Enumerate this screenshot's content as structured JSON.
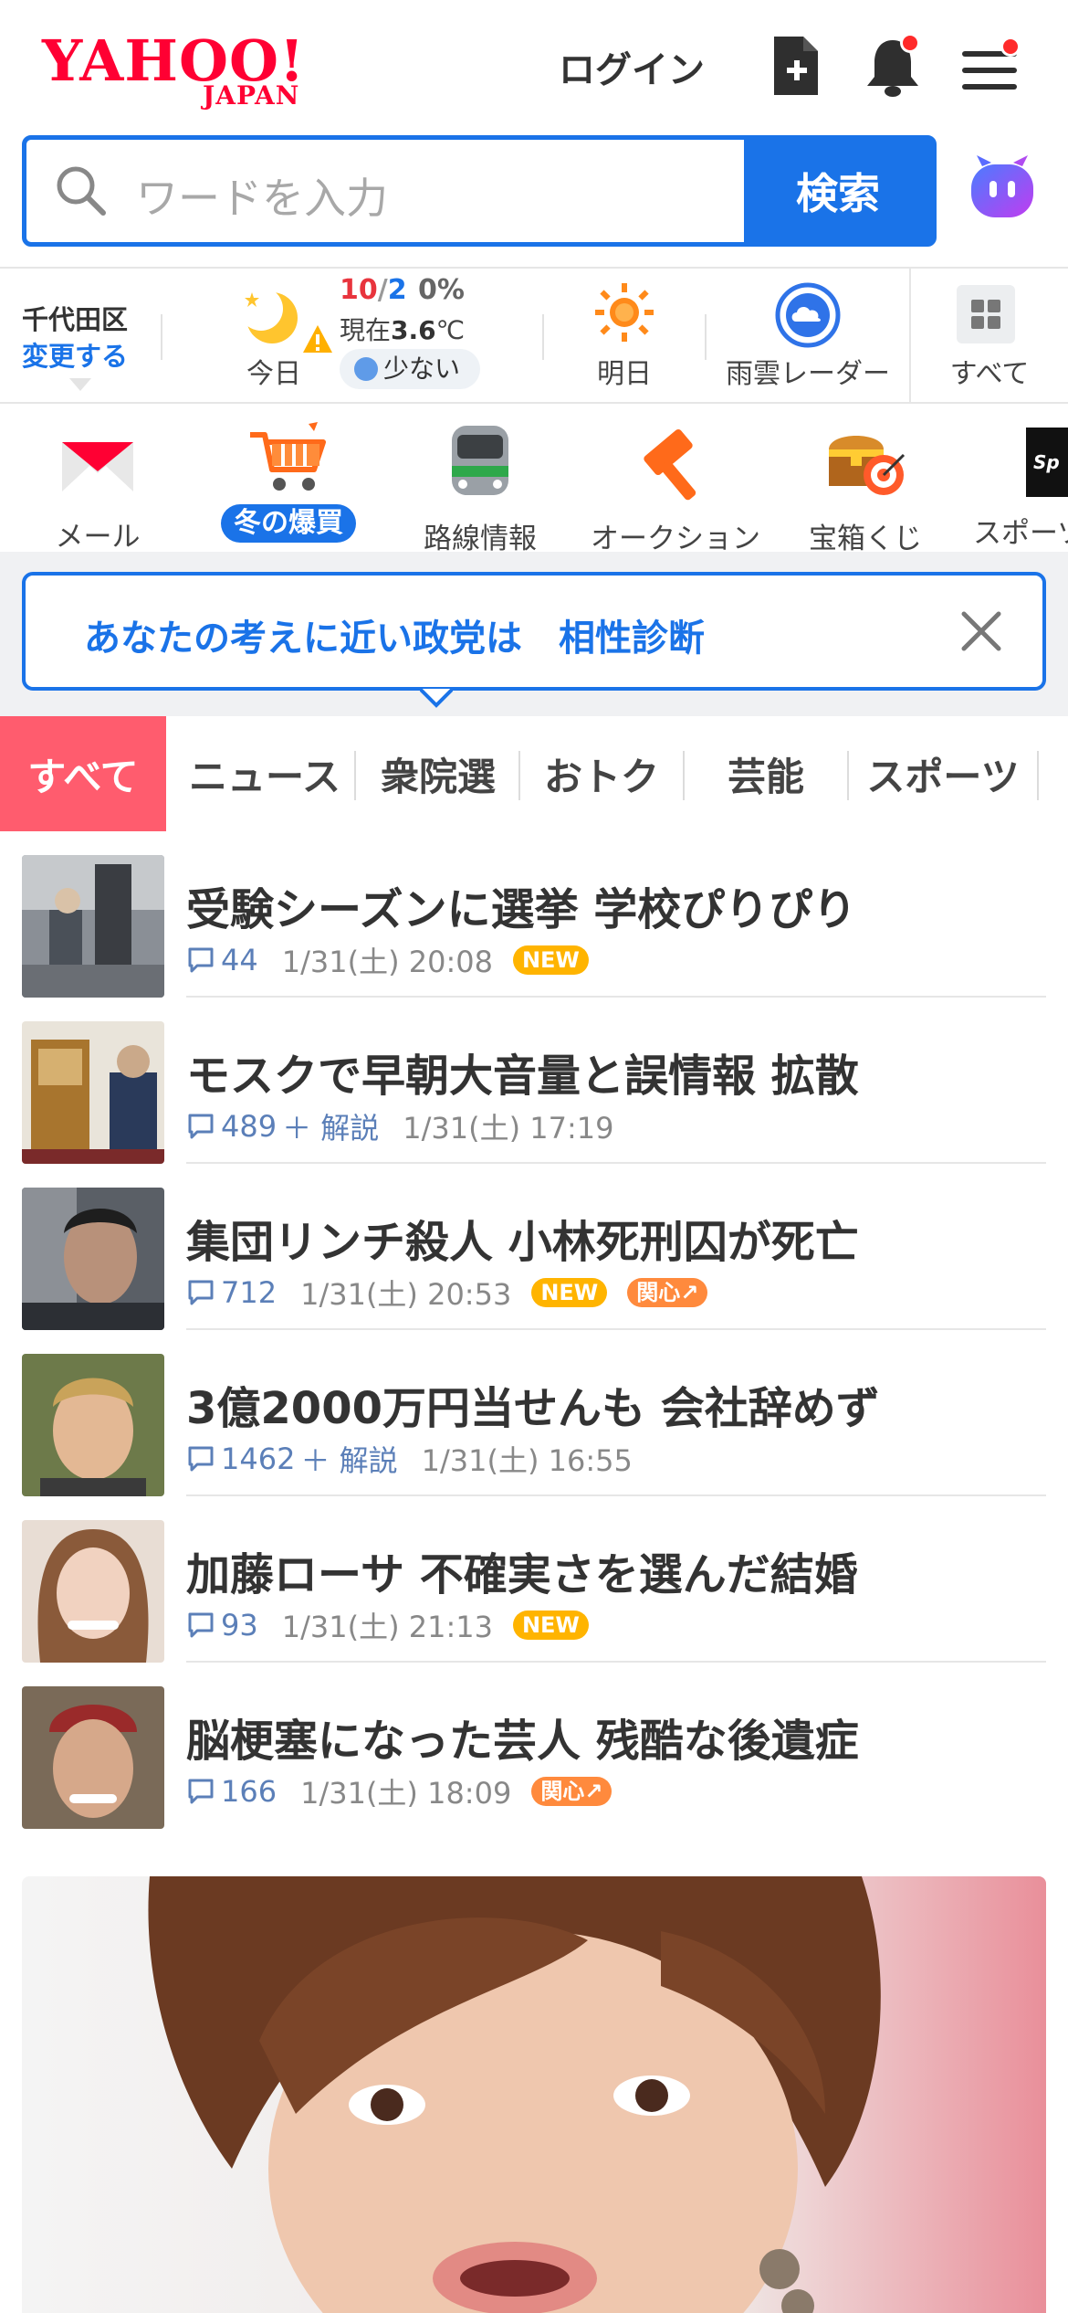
{
  "header": {
    "logo_main": "YAHOO!",
    "logo_sub": "JAPAN",
    "login": "ログイン"
  },
  "search": {
    "placeholder": "ワードを入力",
    "button": "検索"
  },
  "weather": {
    "location": "千代田区",
    "change": "変更する",
    "today_label": "今日",
    "temp_high": "10",
    "temp_slash": "/",
    "temp_low": "2",
    "precip": "0%",
    "current_prefix": "現在",
    "current_temp": "3.6",
    "current_unit": "℃",
    "rain_amount": "少ない",
    "tomorrow_label": "明日",
    "radar_label": "雨雲レーダー",
    "all_label": "すべて"
  },
  "services": [
    {
      "label": "メール"
    },
    {
      "label": "冬の爆買"
    },
    {
      "label": "路線情報"
    },
    {
      "label": "オークション"
    },
    {
      "label": "宝箱くじ"
    },
    {
      "label": "スポーツ"
    }
  ],
  "promo": {
    "text": "あなたの考えに近い政党は　相性診断"
  },
  "tabs": [
    "すべて",
    "ニュース",
    "衆院選",
    "おトク",
    "芸能",
    "スポーツ"
  ],
  "news": [
    {
      "title": "受験シーズンに選挙 学校ぴりぴり",
      "comments": "44",
      "kaisetsu": "",
      "date": "1/31(土) 20:08",
      "new": "NEW",
      "kanshin": ""
    },
    {
      "title": "モスクで早朝大音量と誤情報 拡散",
      "comments": "489",
      "kaisetsu": "＋ 解説",
      "date": "1/31(土) 17:19",
      "new": "",
      "kanshin": ""
    },
    {
      "title": "集団リンチ殺人 小林死刑囚が死亡",
      "comments": "712",
      "kaisetsu": "",
      "date": "1/31(土) 20:53",
      "new": "NEW",
      "kanshin": "関心↗"
    },
    {
      "title": "3億2000万円当せんも 会社辞めず",
      "comments": "1462",
      "kaisetsu": "＋ 解説",
      "date": "1/31(土) 16:55",
      "new": "",
      "kanshin": ""
    },
    {
      "title": "加藤ローサ 不確実さを選んだ結婚",
      "comments": "93",
      "kaisetsu": "",
      "date": "1/31(土) 21:13",
      "new": "NEW",
      "kanshin": ""
    },
    {
      "title": "脳梗塞になった芸人 残酷な後遺症",
      "comments": "166",
      "kaisetsu": "",
      "date": "1/31(土) 18:09",
      "new": "",
      "kanshin": "関心↗"
    }
  ],
  "colors": {
    "brand_red": "#ff0033",
    "accent_blue": "#1a73e8",
    "tab_active": "#ff5c6e",
    "new_badge": "#ffb400",
    "kanshin_badge": "#ff8a3d"
  },
  "icons": [
    "search-icon",
    "add-document-icon",
    "bell-icon",
    "menu-icon",
    "assistant-icon",
    "moon-icon",
    "sun-icon",
    "radar-icon",
    "grid-icon",
    "mail-icon",
    "cart-icon",
    "train-icon",
    "gavel-icon",
    "treasure-icon",
    "close-icon",
    "comment-icon"
  ]
}
